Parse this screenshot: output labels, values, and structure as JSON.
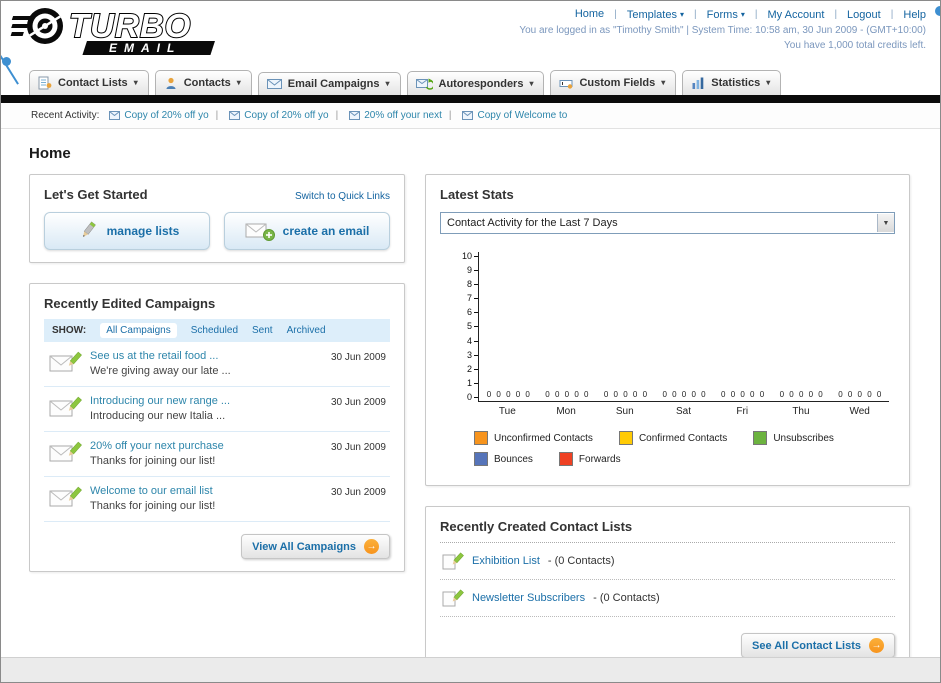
{
  "icons": {
    "caret_down": "▾",
    "select_caret": "▼",
    "arrow_right": "→"
  },
  "header": {
    "logo_primary": "TURBO",
    "logo_secondary": "EMAIL",
    "links": [
      "Home",
      "Templates",
      "Forms",
      "My Account",
      "Logout",
      "Help"
    ],
    "login_info": "You are logged in as \"Timothy Smith\" | System Time: 10:58 am, 30 Jun 2009 - (GMT+10:00)",
    "credits_info": "You have 1,000 total credits left."
  },
  "nav": {
    "tabs": [
      "Contact Lists",
      "Contacts",
      "Email Campaigns",
      "Autoresponders",
      "Custom Fields",
      "Statistics"
    ]
  },
  "recent_activity": {
    "label": "Recent Activity:",
    "items": [
      "Copy of 20% off yo",
      "Copy of 20% off yo",
      "20% off your next",
      "Copy of Welcome to"
    ]
  },
  "page": {
    "title": "Home"
  },
  "get_started": {
    "title": "Let's Get Started",
    "switch_link": "Switch to Quick Links",
    "manage_lists_label": "manage lists",
    "create_email_label": "create an email"
  },
  "campaigns": {
    "title": "Recently Edited Campaigns",
    "show_label": "SHOW:",
    "filters": [
      "All Campaigns",
      "Scheduled",
      "Sent",
      "Archived"
    ],
    "items": [
      {
        "title": "See us at the retail food ...",
        "subtitle": "We're giving away our late ...",
        "date": "30 Jun 2009"
      },
      {
        "title": "Introducing our new range ...",
        "subtitle": "Introducing our new Italia ...",
        "date": "30 Jun 2009"
      },
      {
        "title": "20% off your next purchase",
        "subtitle": "Thanks for joining our list!",
        "date": "30 Jun 2009"
      },
      {
        "title": "Welcome to our email list",
        "subtitle": "Thanks for joining our list!",
        "date": "30 Jun 2009"
      }
    ],
    "view_all_label": "View All Campaigns"
  },
  "stats": {
    "title": "Latest Stats",
    "period_selector": "Contact Activity for the Last 7 Days",
    "chart_data": {
      "type": "bar",
      "categories": [
        "Tue",
        "Mon",
        "Sun",
        "Sat",
        "Fri",
        "Thu",
        "Wed"
      ],
      "series": [
        {
          "name": "Unconfirmed Contacts",
          "color": "#f7941d",
          "values": [
            0,
            0,
            0,
            0,
            0,
            0,
            0
          ]
        },
        {
          "name": "Confirmed Contacts",
          "color": "#ffcb05",
          "values": [
            0,
            0,
            0,
            0,
            0,
            0,
            0
          ]
        },
        {
          "name": "Unsubscribes",
          "color": "#6cb33f",
          "values": [
            0,
            0,
            0,
            0,
            0,
            0,
            0
          ]
        },
        {
          "name": "Bounces",
          "color": "#5674b9",
          "values": [
            0,
            0,
            0,
            0,
            0,
            0,
            0
          ]
        },
        {
          "name": "Forwards",
          "color": "#ef4123",
          "values": [
            0,
            0,
            0,
            0,
            0,
            0,
            0
          ]
        }
      ],
      "ylim": [
        0,
        10
      ],
      "ytick_step": 1,
      "grid": false,
      "legend_position": "bottom",
      "title": "Contact Activity for the Last 7 Days",
      "xlabel": "",
      "ylabel": ""
    }
  },
  "contact_lists": {
    "title": "Recently Created Contact Lists",
    "items": [
      {
        "name": "Exhibition List",
        "detail": "- (0 Contacts)"
      },
      {
        "name": "Newsletter Subscribers",
        "detail": "- (0 Contacts)"
      }
    ],
    "see_all_label": "See All Contact Lists"
  }
}
